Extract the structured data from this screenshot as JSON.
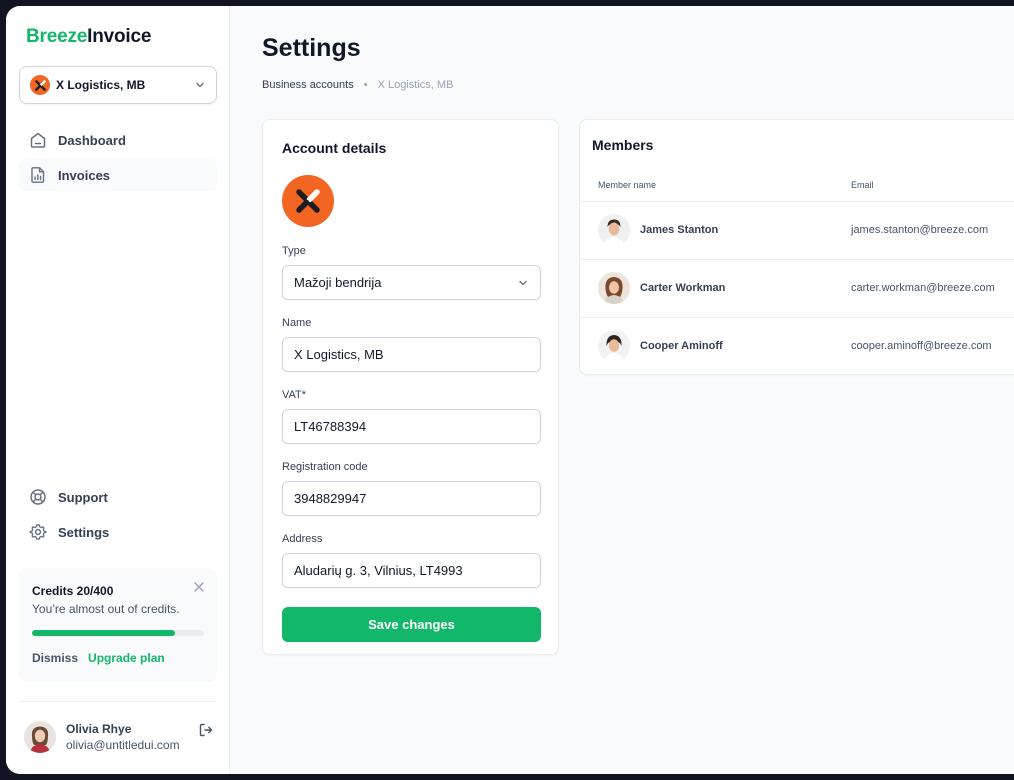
{
  "app": {
    "brand_part1": "Breeze",
    "brand_part2": "Invoice"
  },
  "org_selector": {
    "name": "X Logistics, MB"
  },
  "nav": {
    "dashboard": "Dashboard",
    "invoices": "Invoices",
    "support": "Support",
    "settings": "Settings"
  },
  "credits": {
    "title": "Credits 20/400",
    "message": "You’re almost out of credits.",
    "used_fraction": 0.83,
    "dismiss": "Dismiss",
    "upgrade": "Upgrade plan"
  },
  "user": {
    "name": "Olivia Rhye",
    "email": "olivia@untitledui.com"
  },
  "page": {
    "title": "Settings",
    "breadcrumb": [
      "Business accounts",
      "X Logistics, MB"
    ]
  },
  "account": {
    "title": "Account details",
    "type_label": "Type",
    "type_value": "Mažoji bendrija",
    "name_label": "Name",
    "name_value": "X Logistics, MB",
    "vat_label": "VAT*",
    "vat_value": "LT46788394",
    "reg_label": "Registration code",
    "reg_value": "3948829947",
    "address_label": "Address",
    "address_value": "Aludarių g. 3, Vilnius, LT4993",
    "save_label": "Save changes"
  },
  "members": {
    "title": "Members",
    "col_name": "Member name",
    "col_email": "Email",
    "rows": [
      {
        "name": "James Stanton",
        "email": "james.stanton@breeze.com"
      },
      {
        "name": "Carter Workman",
        "email": "carter.workman@breeze.com"
      },
      {
        "name": "Cooper Aminoff",
        "email": "cooper.aminoff@breeze.com"
      }
    ]
  },
  "colors": {
    "accent": "#12b76a",
    "brand_orange": "#f26522",
    "border": "#d0d5dd"
  },
  "icons": [
    "x-logo-icon",
    "chevron-down-icon",
    "home-icon",
    "invoice-chart-icon",
    "lifebuoy-icon",
    "gear-icon",
    "close-icon",
    "logout-icon"
  ]
}
